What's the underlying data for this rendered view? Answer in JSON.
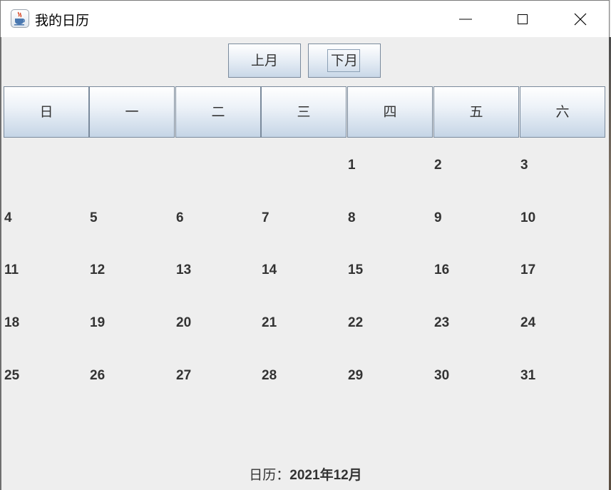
{
  "window": {
    "title": "我的日历",
    "icon": "java-cup-icon"
  },
  "nav": {
    "prev_label": "上月",
    "next_label": "下月"
  },
  "weekdays": [
    "日",
    "一",
    "二",
    "三",
    "四",
    "五",
    "六"
  ],
  "calendar": {
    "weeks": [
      [
        "",
        "",
        "",
        "",
        "1",
        "2",
        "3"
      ],
      [
        "4",
        "5",
        "6",
        "7",
        "8",
        "9",
        "10"
      ],
      [
        "11",
        "12",
        "13",
        "14",
        "15",
        "16",
        "17"
      ],
      [
        "18",
        "19",
        "20",
        "21",
        "22",
        "23",
        "24"
      ],
      [
        "25",
        "26",
        "27",
        "28",
        "29",
        "30",
        "31"
      ]
    ]
  },
  "footer": {
    "prefix": "日历：",
    "value": "2021年12月"
  },
  "colors": {
    "background": "#EEEEEE",
    "titlebar": "#FFFFFF",
    "day_text": "#333333",
    "button_gradient_top": "#FFFFFF",
    "button_gradient_bottom": "#C5D5E6"
  }
}
